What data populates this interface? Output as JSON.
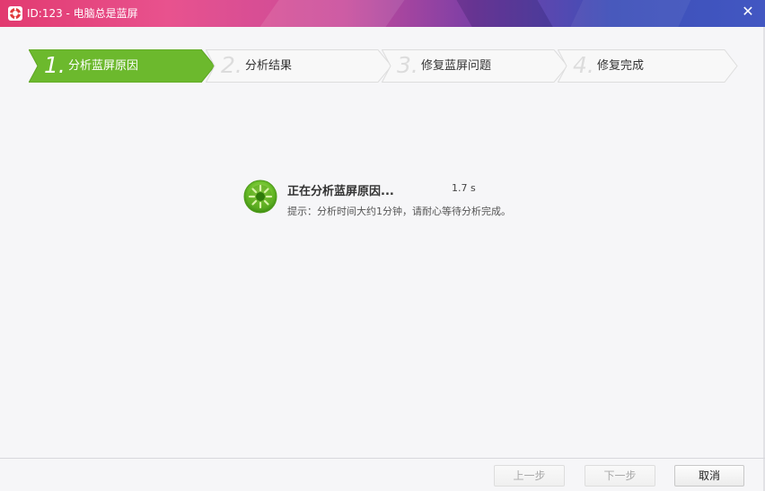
{
  "window": {
    "title": "ID:123 - 电脑总是蓝屏",
    "icon": "lifebuoy-icon",
    "close_glyph": "✕"
  },
  "steps": [
    {
      "number": "1.",
      "label": "分析蓝屏原因",
      "active": true
    },
    {
      "number": "2.",
      "label": "分析结果",
      "active": false
    },
    {
      "number": "3.",
      "label": "修复蓝屏问题",
      "active": false
    },
    {
      "number": "4.",
      "label": "修复完成",
      "active": false
    }
  ],
  "status": {
    "title": "正在分析蓝屏原因...",
    "elapsed": "1.7 s",
    "hint": "提示：分析时间大约1分钟，请耐心等待分析完成。",
    "spinner_icon": "progress-spinner-icon"
  },
  "buttons": {
    "prev": "上一步",
    "next": "下一步",
    "cancel": "取消"
  },
  "colors": {
    "active_step": "#6cb92d",
    "inactive_step": "#f7f7f7",
    "spinner_green": "#5fb322"
  }
}
